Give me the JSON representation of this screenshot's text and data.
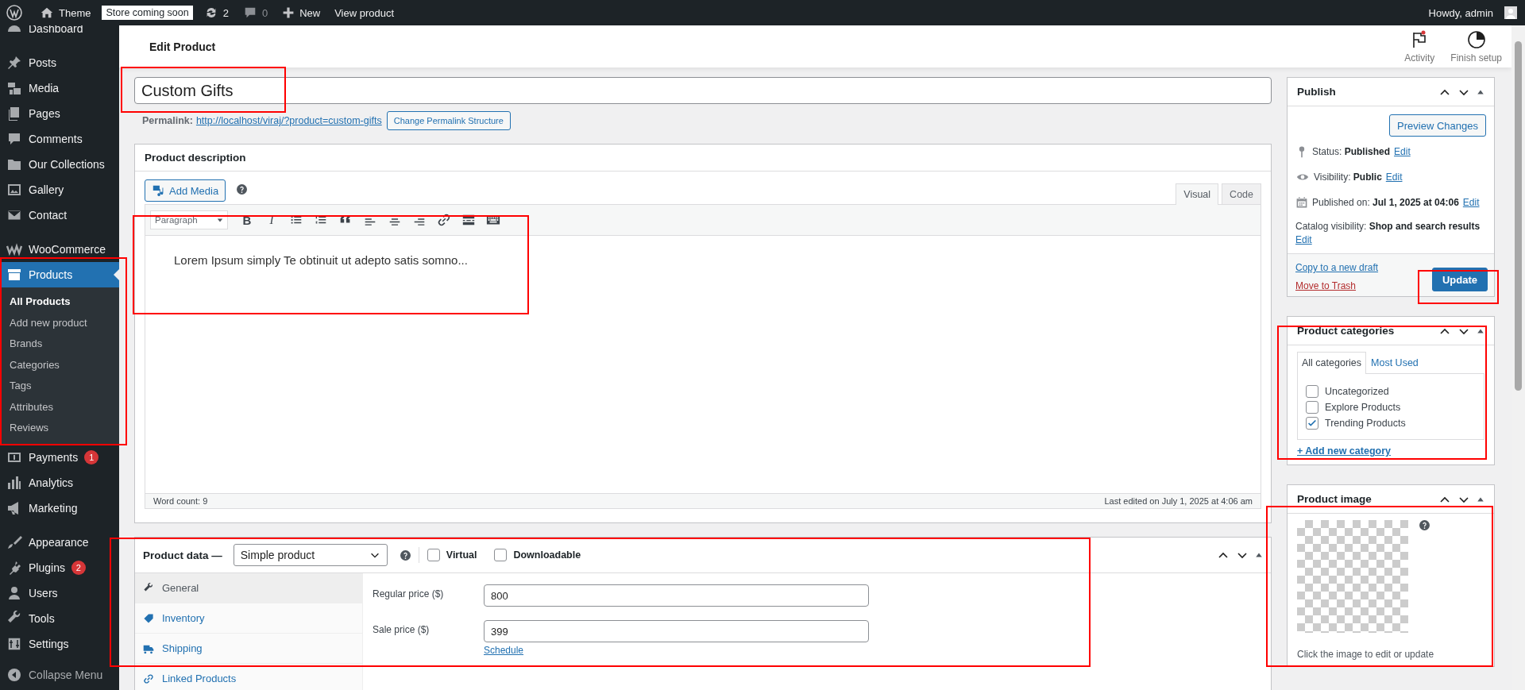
{
  "admin_bar": {
    "site": "Theme",
    "store_badge": "Store coming soon",
    "updates": "2",
    "comments": "0",
    "new_label": "New",
    "view_label": "View product",
    "greeting": "Howdy, admin"
  },
  "sidebar": {
    "groups": [
      {
        "items": [
          {
            "label": "Dashboard",
            "selected": false
          }
        ]
      },
      {
        "items": [
          {
            "label": "Posts",
            "selected": false
          },
          {
            "label": "Media",
            "selected": false
          },
          {
            "label": "Pages",
            "selected": false
          },
          {
            "label": "Comments",
            "selected": false
          },
          {
            "label": "Our Collections",
            "selected": false
          },
          {
            "label": "Gallery",
            "selected": false
          },
          {
            "label": "Contact",
            "selected": false
          }
        ]
      },
      {
        "items": [
          {
            "label": "WooCommerce",
            "selected": false
          },
          {
            "label": "Products",
            "selected": true,
            "children": [
              {
                "label": "All Products",
                "selected": true
              },
              {
                "label": "Add new product",
                "selected": false
              },
              {
                "label": "Brands",
                "selected": false
              },
              {
                "label": "Categories",
                "selected": false
              },
              {
                "label": "Tags",
                "selected": false
              },
              {
                "label": "Attributes",
                "selected": false
              },
              {
                "label": "Reviews",
                "selected": false
              }
            ]
          },
          {
            "label": "Payments",
            "selected": false,
            "badge": "1"
          },
          {
            "label": "Analytics",
            "selected": false
          },
          {
            "label": "Marketing",
            "selected": false
          }
        ]
      },
      {
        "items": [
          {
            "label": "Appearance",
            "selected": false
          },
          {
            "label": "Plugins",
            "selected": false,
            "badge": "2"
          },
          {
            "label": "Users",
            "selected": false
          },
          {
            "label": "Tools",
            "selected": false
          },
          {
            "label": "Settings",
            "selected": false
          }
        ]
      }
    ],
    "collapse": "Collapse Menu"
  },
  "header": {
    "title": "Edit Product",
    "actions": [
      {
        "label": "Activity",
        "kind": "activity"
      },
      {
        "label": "Finish setup",
        "kind": "progress"
      }
    ]
  },
  "title_field": {
    "value": "Custom Gifts"
  },
  "permalink": {
    "label": "Permalink:",
    "url": "http://localhost/viraj/?product=custom-gifts",
    "button": "Change Permalink Structure"
  },
  "description": {
    "title": "Product description",
    "add_media": "Add Media",
    "tabs": [
      {
        "label": "Visual",
        "selected": true
      },
      {
        "label": "Code",
        "selected": false
      }
    ],
    "format": "Paragraph",
    "tools": [
      {
        "kind": "bold",
        "glyph": "B"
      },
      {
        "kind": "italic",
        "glyph": "I"
      },
      {
        "kind": "bullets"
      },
      {
        "kind": "numbers"
      },
      {
        "kind": "quote"
      },
      {
        "kind": "align-left"
      },
      {
        "kind": "align-center"
      },
      {
        "kind": "align-right"
      },
      {
        "kind": "link"
      },
      {
        "kind": "more"
      },
      {
        "kind": "keyboard"
      }
    ],
    "content": "Lorem Ipsum simply Te obtinuit ut adepto satis somno...",
    "word_count": "Word count: 9",
    "last_edited": "Last edited on July 1, 2025 at 4:06 am"
  },
  "product_data": {
    "title": "Product data —",
    "type": "Simple product",
    "options": [
      {
        "label": "Virtual",
        "checked": false
      },
      {
        "label": "Downloadable",
        "checked": false
      }
    ],
    "tabs": [
      {
        "label": "General",
        "kind": "wrench",
        "selected": true
      },
      {
        "label": "Inventory",
        "kind": "tag",
        "selected": false
      },
      {
        "label": "Shipping",
        "kind": "truck",
        "selected": false
      },
      {
        "label": "Linked Products",
        "kind": "link",
        "selected": false
      }
    ],
    "fields": [
      {
        "label": "Regular price ($)",
        "value": "800"
      },
      {
        "label": "Sale price ($)",
        "value": "399",
        "link": "Schedule"
      }
    ]
  },
  "publish": {
    "title": "Publish",
    "preview": "Preview Changes",
    "rows": [
      {
        "kind": "status",
        "label": "Status:",
        "value": "Published",
        "action": "Edit"
      },
      {
        "kind": "visibility",
        "label": "Visibility:",
        "value": "Public",
        "action": "Edit"
      },
      {
        "kind": "date",
        "label": "Published on:",
        "value": "Jul 1, 2025 at 04:06",
        "action": "Edit"
      },
      {
        "kind": "catalog",
        "label": "Catalog visibility:",
        "value": "Shop and search results",
        "action": "Edit"
      }
    ],
    "copy_link": "Copy to a new draft",
    "trash_link": "Move to Trash",
    "update": "Update"
  },
  "categories": {
    "title": "Product categories",
    "tabs": [
      {
        "label": "All categories",
        "selected": true
      },
      {
        "label": "Most Used",
        "selected": false
      }
    ],
    "items": [
      {
        "label": "Uncategorized",
        "checked": false
      },
      {
        "label": "Explore Products",
        "checked": false
      },
      {
        "label": "Trending Products",
        "checked": true
      }
    ],
    "add_link": "+ Add new category"
  },
  "product_image": {
    "title": "Product image",
    "caption": "Click the image to edit or update"
  }
}
